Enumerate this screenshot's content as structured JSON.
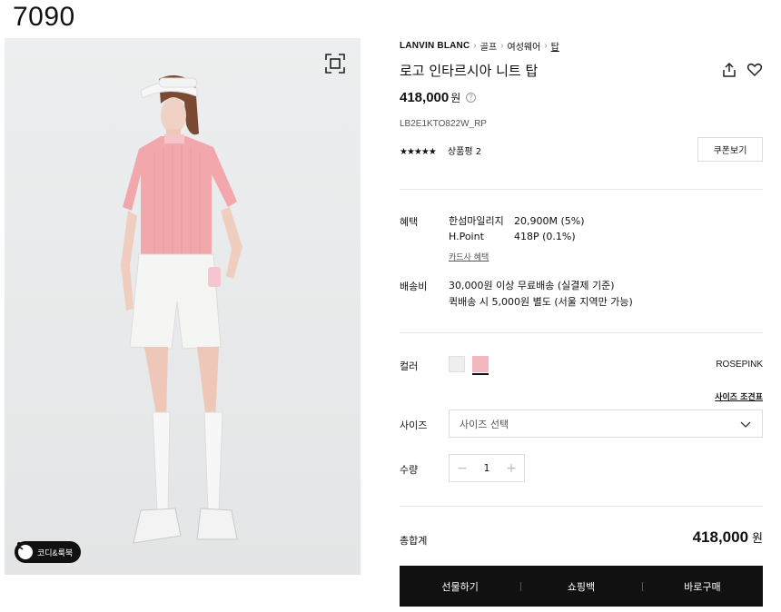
{
  "page_id": "7090",
  "gallery": {
    "coordi_label": "코디&룩북"
  },
  "breadcrumb": {
    "brand": "LANVIN BLANC",
    "items": [
      "골프",
      "여성웨어",
      "탑"
    ]
  },
  "product": {
    "title": "로고 인타르시아 니트 탑",
    "price": "418,000",
    "price_unit": "원",
    "code": "LB2E1KTO822W_RP",
    "stars": "★★★★★",
    "review_label": "상품평 2",
    "coupon_label": "쿠폰보기"
  },
  "benefits": {
    "label": "혜택",
    "items": [
      {
        "name": "한섬마일리지",
        "value": "20,900M (5%)"
      },
      {
        "name": "H.Point",
        "value": "418P (0.1%)"
      }
    ],
    "card_link": "카드사 혜택"
  },
  "shipping": {
    "label": "배송비",
    "lines": [
      "30,000원 이상 무료배송 (실결제 기준)",
      "퀵배송 시 5,000원 별도 (서울 지역만 가능)"
    ]
  },
  "color": {
    "label": "컬러",
    "selected_name": "ROSEPINK",
    "swatches": [
      {
        "name": "white",
        "hex": "#eeeeee"
      },
      {
        "name": "rosepink",
        "hex": "#f2b8bf"
      }
    ]
  },
  "size": {
    "label": "사이즈",
    "guide_label": "사이즈 조견표",
    "placeholder": "사이즈 선택"
  },
  "quantity": {
    "label": "수량",
    "value": "1",
    "minus": "−",
    "plus": "+"
  },
  "total": {
    "label": "총합계",
    "price": "418,000",
    "unit": "원"
  },
  "actions": {
    "gift": "선물하기",
    "bag": "쇼핑백",
    "buy": "바로구매"
  }
}
